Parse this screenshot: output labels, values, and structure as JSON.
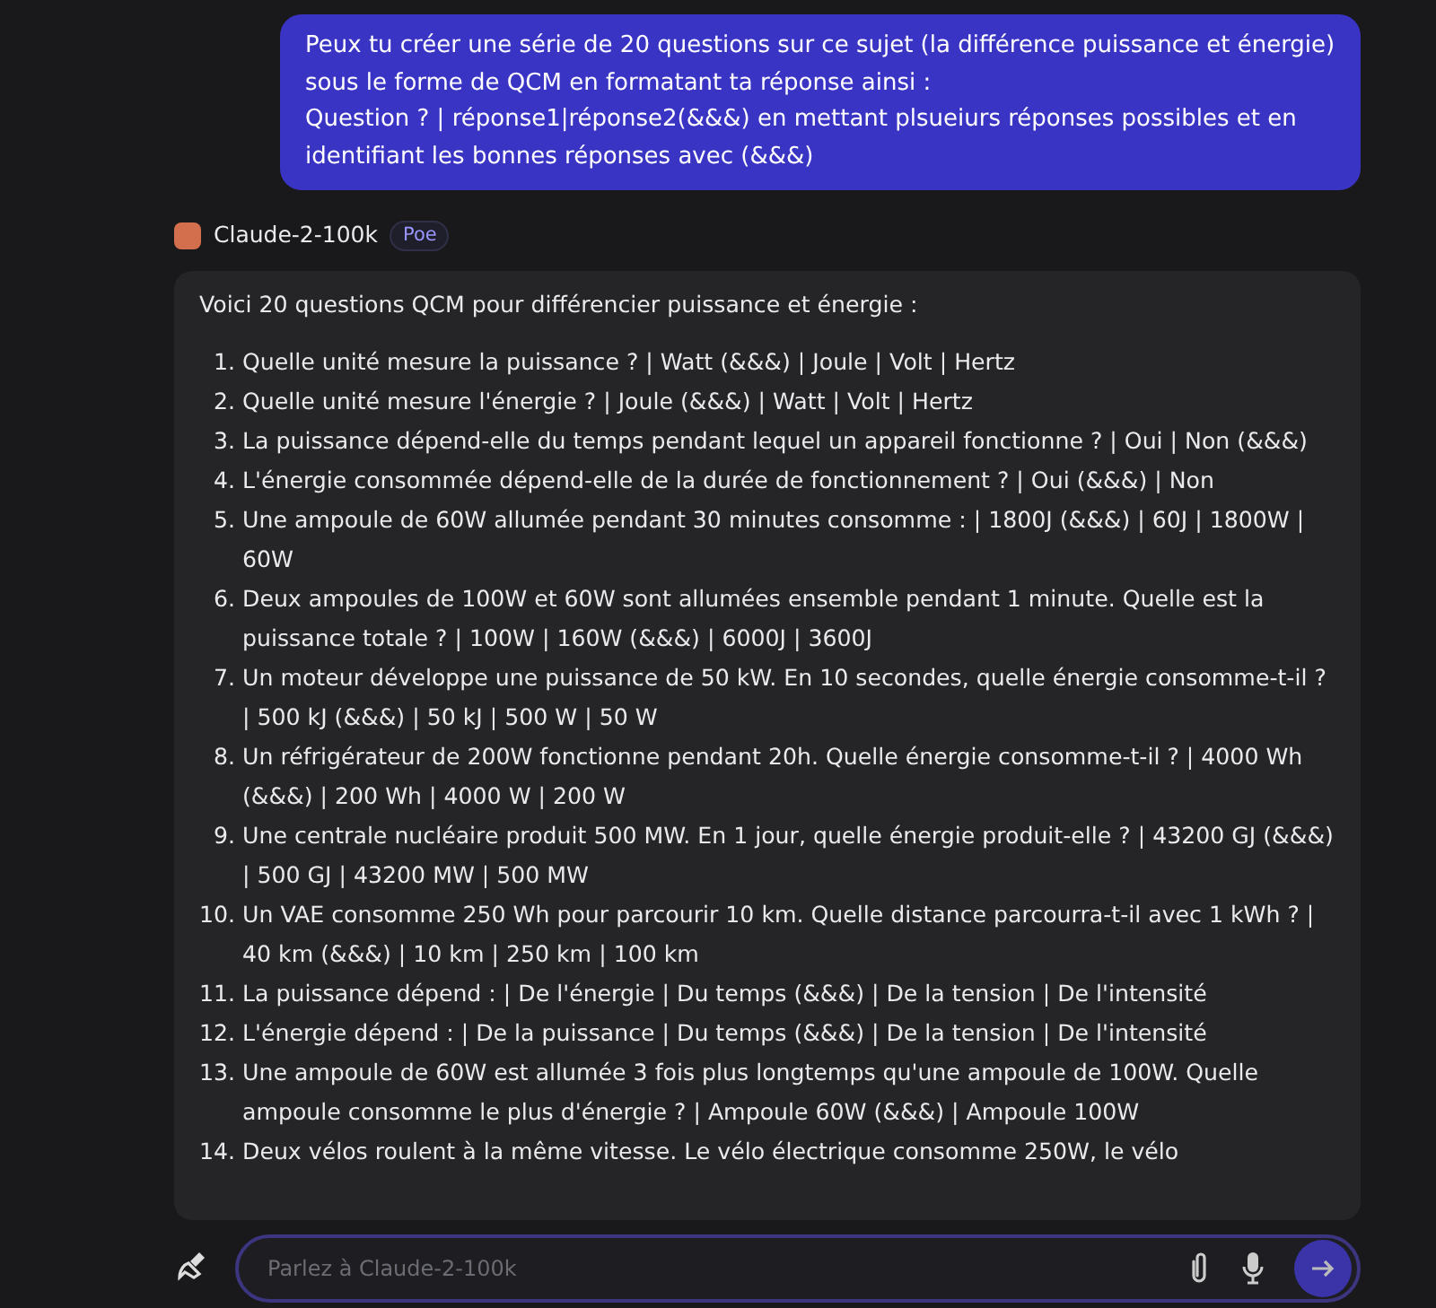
{
  "user_message": {
    "text": "Peux tu créer une série de 20 questions sur ce sujet (la différence puissance et énergie) sous le forme de QCM en formatant ta réponse ainsi :\nQuestion ? | réponse1|réponse2(&&&) en mettant plsueiurs réponses possibles et en identifiant les bonnes réponses avec (&&&)"
  },
  "bot": {
    "name": "Claude-2-100k",
    "badge": "Poe"
  },
  "response": {
    "intro": "Voici 20 questions QCM pour différencier puissance et énergie :",
    "items": [
      {
        "number": "1.",
        "text": "Quelle unité mesure la puissance ? | Watt (&&&) | Joule | Volt | Hertz"
      },
      {
        "number": "2.",
        "text": "Quelle unité mesure l'énergie ? | Joule (&&&) | Watt | Volt | Hertz"
      },
      {
        "number": "3.",
        "text": "La puissance dépend-elle du temps pendant lequel un appareil fonctionne ? | Oui | Non (&&&)"
      },
      {
        "number": "4.",
        "text": "L'énergie consommée dépend-elle de la durée de fonctionnement ? | Oui (&&&) | Non"
      },
      {
        "number": "5.",
        "text": "Une ampoule de 60W allumée pendant 30 minutes consomme : | 1800J (&&&) | 60J | 1800W | 60W"
      },
      {
        "number": "6.",
        "text": "Deux ampoules de 100W et 60W sont allumées ensemble pendant 1 minute. Quelle est la puissance totale ? | 100W | 160W (&&&) | 6000J | 3600J"
      },
      {
        "number": "7.",
        "text": "Un moteur développe une puissance de 50 kW. En 10 secondes, quelle énergie consomme-t-il ? | 500 kJ (&&&) | 50 kJ | 500 W | 50 W"
      },
      {
        "number": "8.",
        "text": "Un réfrigérateur de 200W fonctionne pendant 20h. Quelle énergie consomme-t-il ? | 4000 Wh (&&&) | 200 Wh | 4000 W | 200 W"
      },
      {
        "number": "9.",
        "text": "Une centrale nucléaire produit 500 MW. En 1 jour, quelle énergie produit-elle ? | 43200 GJ (&&&) | 500 GJ | 43200 MW | 500 MW"
      },
      {
        "number": "10.",
        "text": "Un VAE consomme 250 Wh pour parcourir 10 km. Quelle distance parcourra-t-il avec 1 kWh ? | 40 km (&&&) | 10 km | 250 km | 100 km"
      },
      {
        "number": "11.",
        "text": "La puissance dépend : | De l'énergie | Du temps (&&&) | De la tension | De l'intensité"
      },
      {
        "number": "12.",
        "text": "L'énergie dépend : | De la puissance | Du temps (&&&) | De la tension | De l'intensité"
      },
      {
        "number": "13.",
        "text": "Une ampoule de 60W est allumée 3 fois plus longtemps qu'une ampoule de 100W. Quelle ampoule consomme le plus d'énergie ? | Ampoule 60W (&&&) | Ampoule 100W"
      },
      {
        "number": "14.",
        "text": "Deux vélos roulent à la même vitesse. Le vélo électrique consomme 250W, le vélo"
      }
    ]
  },
  "composer": {
    "placeholder": "Parlez à Claude-2-100k"
  }
}
